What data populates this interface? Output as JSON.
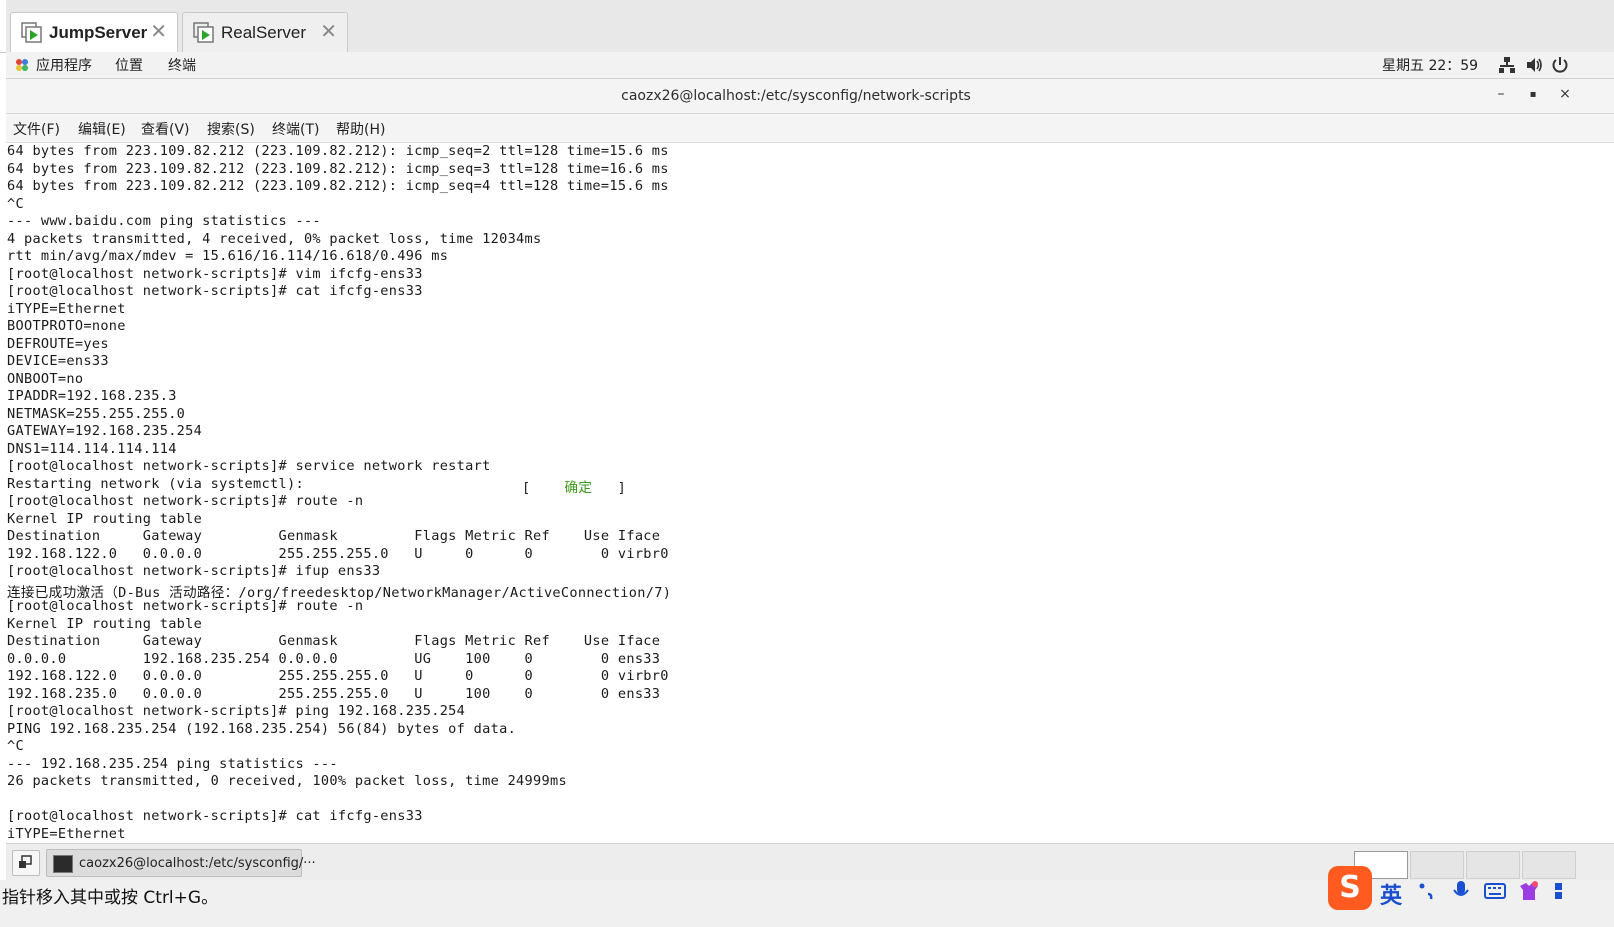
{
  "vm_tabs": [
    {
      "label": "JumpServer",
      "active": true
    },
    {
      "label": "RealServer",
      "active": false
    }
  ],
  "topbar": {
    "menus": [
      "应用程序",
      "位置",
      "终端"
    ],
    "clock": "星期五 22：59",
    "tray_icons": [
      "network-icon",
      "volume-icon",
      "power-icon"
    ]
  },
  "window": {
    "title": "caozx26@localhost:/etc/sysconfig/network-scripts",
    "controls": [
      "–",
      "▪",
      "×"
    ]
  },
  "menubar": [
    "文件(F)",
    "编辑(E)",
    "查看(V)",
    "搜索(S)",
    "终端(T)",
    "帮助(H)"
  ],
  "terminal": {
    "lines": [
      "64 bytes from 223.109.82.212 (223.109.82.212): icmp_seq=2 ttl=128 time=15.6 ms",
      "64 bytes from 223.109.82.212 (223.109.82.212): icmp_seq=3 ttl=128 time=16.6 ms",
      "64 bytes from 223.109.82.212 (223.109.82.212): icmp_seq=4 ttl=128 time=15.6 ms",
      "^C",
      "--- www.baidu.com ping statistics ---",
      "4 packets transmitted, 4 received, 0% packet loss, time 12034ms",
      "rtt min/avg/max/mdev = 15.616/16.114/16.618/0.496 ms",
      "[root@localhost network-scripts]# vim ifcfg-ens33",
      "[root@localhost network-scripts]# cat ifcfg-ens33",
      "iTYPE=Ethernet",
      "BOOTPROTO=none",
      "DEFROUTE=yes",
      "DEVICE=ens33",
      "ONBOOT=no",
      "IPADDR=192.168.235.3",
      "NETMASK=255.255.255.0",
      "GATEWAY=192.168.235.254",
      "DNS1=114.114.114.114",
      "[root@localhost network-scripts]# service network restart",
      "Restarting network (via systemctl):",
      "[root@localhost network-scripts]# route -n",
      "Kernel IP routing table",
      "Destination     Gateway         Genmask         Flags Metric Ref    Use Iface",
      "192.168.122.0   0.0.0.0         255.255.255.0   U     0      0        0 virbr0",
      "[root@localhost network-scripts]# ifup ens33",
      "连接已成功激活（D-Bus 活动路径：/org/freedesktop/NetworkManager/ActiveConnection/7)",
      "[root@localhost network-scripts]# route -n",
      "Kernel IP routing table",
      "Destination     Gateway         Genmask         Flags Metric Ref    Use Iface",
      "0.0.0.0         192.168.235.254 0.0.0.0         UG    100    0        0 ens33",
      "192.168.122.0   0.0.0.0         255.255.255.0   U     0      0        0 virbr0",
      "192.168.235.0   0.0.0.0         255.255.255.0   U     100    0        0 ens33",
      "[root@localhost network-scripts]# ping 192.168.235.254",
      "PING 192.168.235.254 (192.168.235.254) 56(84) bytes of data.",
      "^C",
      "--- 192.168.235.254 ping statistics ---",
      "26 packets transmitted, 0 received, 100% packet loss, time 24999ms",
      "",
      "[root@localhost network-scripts]# cat ifcfg-ens33",
      "iTYPE=Ethernet"
    ],
    "restart_status": {
      "open": "[",
      "text": "确定",
      "close": "]"
    },
    "ok_color": "#3c9a1e"
  },
  "taskbar": {
    "task_label": "caozx26@localhost:/etc/sysconfig/···",
    "workspaces": 4
  },
  "status_hint": "指针移入其中或按 Ctrl+G。",
  "ime": {
    "logo": "S",
    "lang": "英"
  }
}
